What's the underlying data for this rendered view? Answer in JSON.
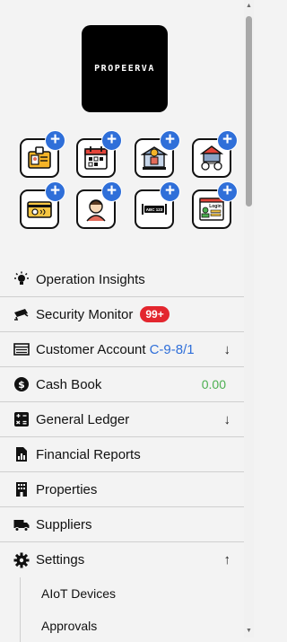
{
  "logo": {
    "text": "PROPEERVA"
  },
  "quick_actions": [
    {
      "icon": "id-badge-icon"
    },
    {
      "icon": "calendar-icon"
    },
    {
      "icon": "bank-icon"
    },
    {
      "icon": "property-network-icon"
    },
    {
      "icon": "key-card-icon"
    },
    {
      "icon": "tenant-icon"
    },
    {
      "icon": "license-plate-icon",
      "text": "ABC 123"
    },
    {
      "icon": "login-screen-icon",
      "text": "Login"
    }
  ],
  "menu": [
    {
      "label": "Operation Insights",
      "icon": "lightbulb-icon"
    },
    {
      "label": "Security Monitor",
      "icon": "cctv-icon",
      "badge": "99+"
    },
    {
      "label": "Customer Account",
      "icon": "account-card-icon",
      "extra": "C-9-8/1",
      "arrow": "↓"
    },
    {
      "label": "Cash Book",
      "icon": "dollar-circle-icon",
      "amount": "0.00"
    },
    {
      "label": "General Ledger",
      "icon": "calculator-icon",
      "arrow": "↓"
    },
    {
      "label": "Financial Reports",
      "icon": "report-icon"
    },
    {
      "label": "Properties",
      "icon": "building-icon"
    },
    {
      "label": "Suppliers",
      "icon": "truck-icon"
    },
    {
      "label": "Settings",
      "icon": "gear-icon",
      "arrow": "↑"
    }
  ],
  "settings_submenu": [
    {
      "label": "AIoT Devices"
    },
    {
      "label": "Approvals"
    }
  ],
  "colors": {
    "accent": "#2f6fd9",
    "badge": "#e3262e",
    "amount": "#4caf50"
  }
}
